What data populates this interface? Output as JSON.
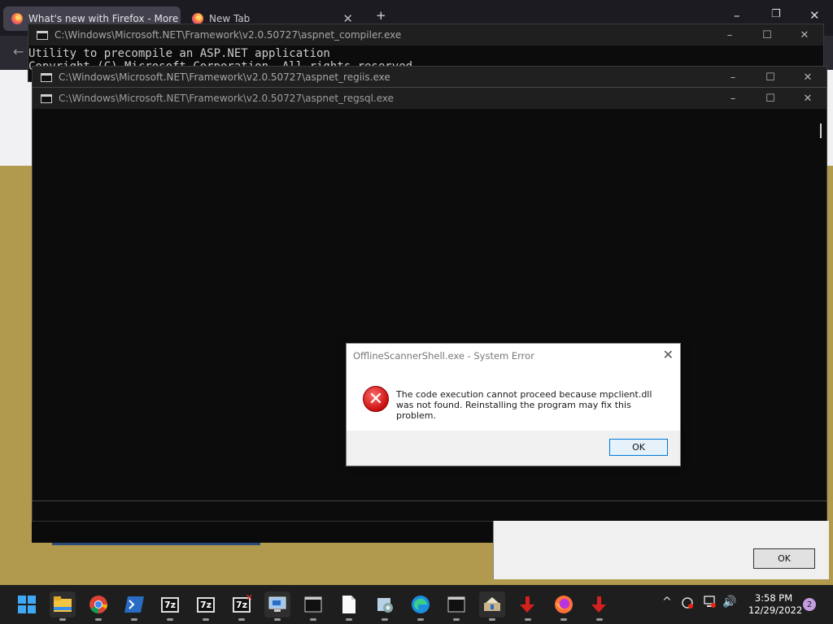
{
  "firefox": {
    "tabs": [
      {
        "label": "What's new with Firefox - More"
      },
      {
        "label": "New Tab"
      }
    ],
    "new_tab_symbol": "+",
    "caption_buttons": [
      "–",
      "❐",
      "✕"
    ]
  },
  "console_windows": [
    {
      "title": "C:\\Windows\\Microsoft.NET\\Framework\\v2.0.50727\\aspnet_compiler.exe",
      "lines": [
        "Utility to precompile an ASP.NET application",
        "Copyright (C) Microsoft Corporation. All rights reserved."
      ]
    },
    {
      "title": "C:\\Windows\\Microsoft.NET\\Framework\\v2.0.50727\\aspnet_regiis.exe"
    },
    {
      "title": "C:\\Windows\\Microsoft.NET\\Framework\\v2.0.50727\\aspnet_regsql.exe"
    }
  ],
  "window_controls": {
    "minimize": "–",
    "maximize": "☐",
    "close": "✕"
  },
  "background_dialog": {
    "ok_label": "OK"
  },
  "error_dialog": {
    "title": "OfflineScannerShell.exe - System Error",
    "close_symbol": "✕",
    "icon": "error-x-icon",
    "icon_glyph": "✕",
    "message": "The code execution cannot proceed because mpclient.dll was not found. Reinstalling the program may fix this problem.",
    "ok_label": "OK"
  },
  "taskbar": {
    "icons": [
      "start-icon",
      "file-explorer-icon",
      "chrome-icon",
      "powershell-icon",
      "7zip-icon",
      "7zip-icon",
      "7zip-remove-icon",
      "remote-desktop-icon",
      "console-app-icon",
      "blank-file-icon",
      "settings-tool-icon",
      "edge-icon",
      "console-app-icon",
      "installer-icon",
      "red-arrow-icon",
      "firefox-icon",
      "red-arrow-icon"
    ],
    "icon_labels": {
      "sevenzip": "7z"
    },
    "tray_symbols": {
      "chevron": "^",
      "volume": "🔊"
    },
    "time": "3:58 PM",
    "date": "12/29/2022",
    "notification_count": "2"
  },
  "colors": {
    "accent": "#0078d7",
    "error_red": "#c80f0f",
    "taskbar": "#1e1e1e"
  }
}
